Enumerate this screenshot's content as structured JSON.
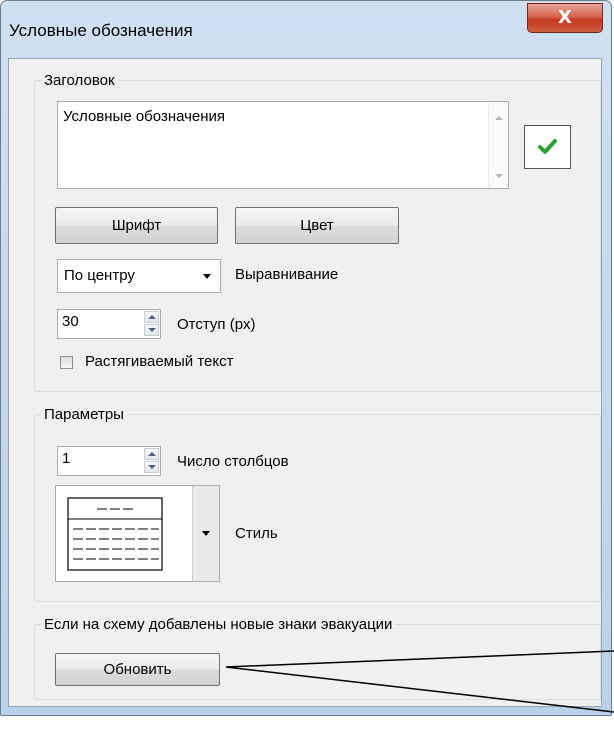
{
  "window": {
    "title": "Условные обозначения",
    "close_glyph": "X"
  },
  "header_group": {
    "legend": "Заголовок",
    "title_text": "Условные обозначения",
    "font_button": "Шрифт",
    "color_button": "Цвет",
    "alignment_value": "По центру",
    "alignment_label": "Выравнивание",
    "indent_value": "30",
    "indent_label": "Отступ (px)",
    "stretch_label": "Растягиваемый текст",
    "stretch_checked": false
  },
  "params_group": {
    "legend": "Параметры",
    "columns_value": "1",
    "columns_label": "Число столбцов",
    "style_label": "Стиль"
  },
  "update_group": {
    "legend": "Если на схему добавлены новые знаки эвакуации",
    "update_button": "Обновить"
  },
  "icons": {
    "apply": "check-icon",
    "close": "close-icon",
    "style_preview": "table-style-icon"
  },
  "colors": {
    "check_green": "#2ea036",
    "close_red": "#c2391f"
  }
}
